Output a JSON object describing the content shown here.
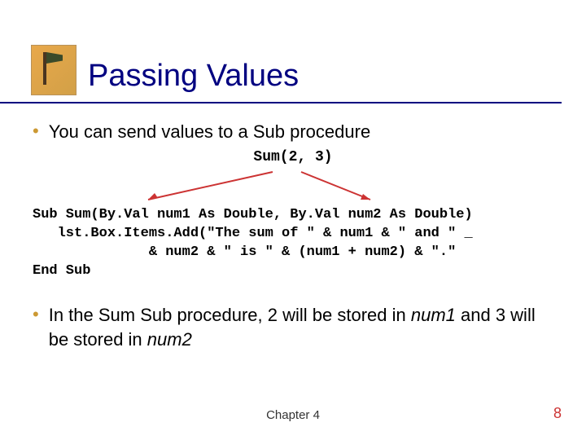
{
  "title": "Passing Values",
  "bullets": {
    "b1": "You can send values to a Sub procedure",
    "b2_pre": "In the Sum Sub procedure, 2 will be stored in ",
    "b2_num1": "num1",
    "b2_mid": " and 3 will be stored in ",
    "b2_num2": "num2"
  },
  "code": {
    "call": "Sum(2, 3)",
    "line1": "Sub Sum(By.Val num1 As Double, By.Val num2 As Double)",
    "line2": "   lst.Box.Items.Add(\"The sum of \" & num1 & \" and \" _",
    "line3": "              & num2 & \" is \" & (num1 + num2) & \".\"",
    "line4": "End Sub"
  },
  "footer": {
    "chapter": "Chapter 4",
    "page": "8"
  },
  "colors": {
    "title": "#000080",
    "accent": "#cc9933",
    "page_num": "#cc3333"
  }
}
